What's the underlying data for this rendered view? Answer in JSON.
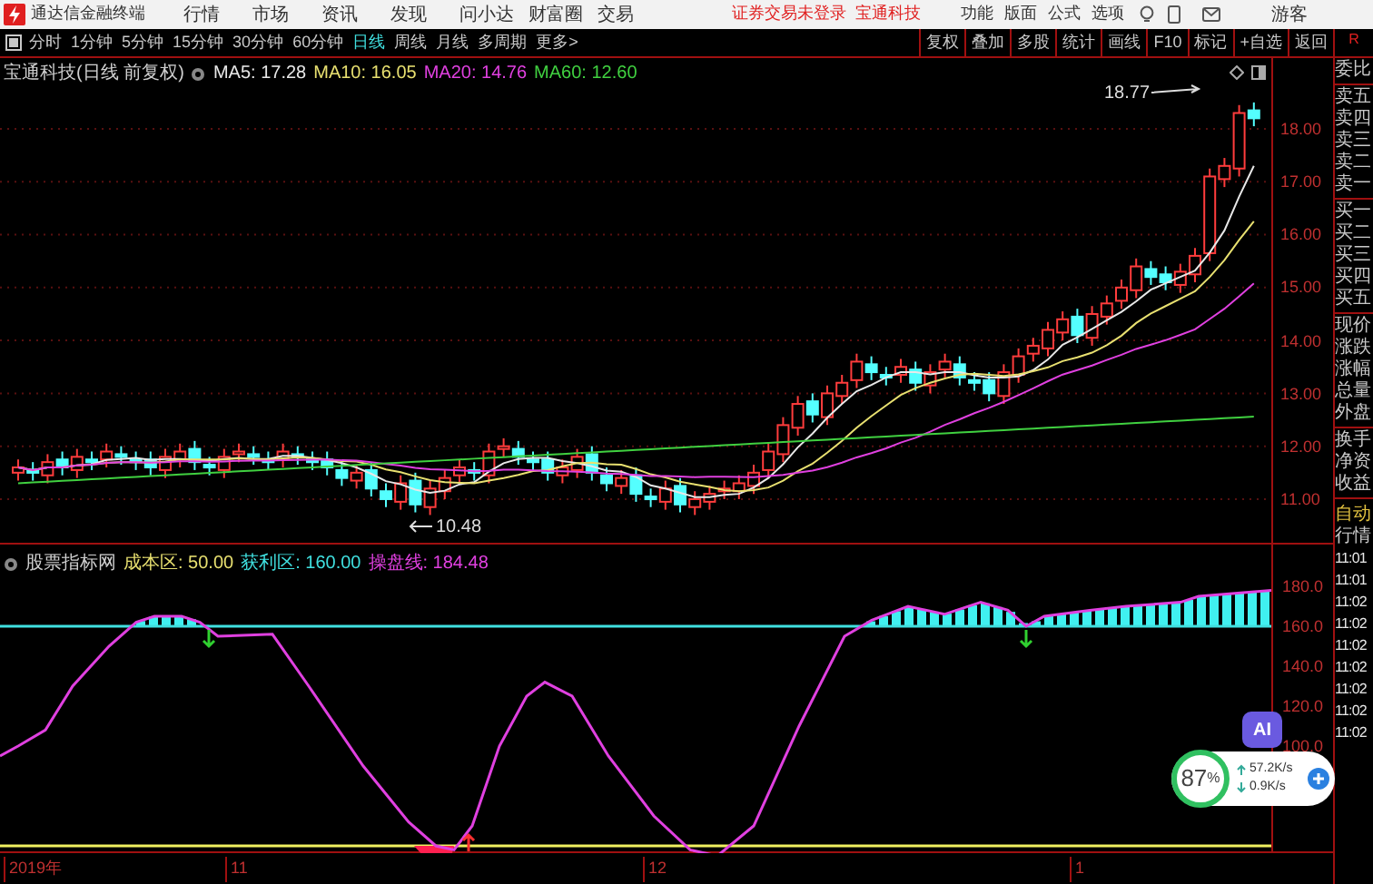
{
  "title_bar": {
    "app_name": "通达信金融终端",
    "menus": [
      "行情",
      "市场",
      "资讯",
      "发现",
      "问小达",
      "财富圈",
      "交易"
    ],
    "login_status": "证券交易未登录",
    "stock_name": "宝通科技",
    "tools": [
      "功能",
      "版面",
      "公式",
      "选项"
    ],
    "user": "游客"
  },
  "period_tabs": [
    {
      "label": "分时",
      "selected": false
    },
    {
      "label": "1分钟",
      "selected": false
    },
    {
      "label": "5分钟",
      "selected": false
    },
    {
      "label": "15分钟",
      "selected": false
    },
    {
      "label": "30分钟",
      "selected": false
    },
    {
      "label": "60分钟",
      "selected": false
    },
    {
      "label": "日线",
      "selected": true
    },
    {
      "label": "周线",
      "selected": false
    },
    {
      "label": "月线",
      "selected": false
    },
    {
      "label": "多周期",
      "selected": false
    },
    {
      "label": "更多>",
      "selected": false
    }
  ],
  "toolbar_buttons": [
    "复权",
    "叠加",
    "多股",
    "统计",
    "画线",
    "F10",
    "标记",
    "+自选",
    "返回"
  ],
  "panel_mark": "R",
  "main_chart": {
    "title": "宝通科技(日线 前复权)",
    "indicators": [
      {
        "label": "MA5: 17.28",
        "color": "#e8e8e8"
      },
      {
        "label": "MA10: 16.05",
        "color": "#e8e070"
      },
      {
        "label": "MA20: 14.76",
        "color": "#e040e0"
      },
      {
        "label": "MA60: 12.60",
        "color": "#40d040"
      }
    ],
    "high_label": "18.77",
    "low_label": "10.48",
    "price_ticks": [
      "18.00",
      "17.00",
      "16.00",
      "15.00",
      "14.00",
      "13.00",
      "12.00",
      "11.00"
    ]
  },
  "indicator_pane": {
    "title": "股票指标网",
    "values": [
      {
        "label": "成本区: 50.00",
        "color": "#e8e070"
      },
      {
        "label": "获利区: 160.00",
        "color": "#40e0e0"
      },
      {
        "label": "操盘线: 184.48",
        "color": "#e040e0"
      }
    ],
    "ticks": [
      "180.0",
      "160.0",
      "140.0",
      "120.0",
      "100.0"
    ]
  },
  "date_axis": [
    "2019年",
    "11",
    "12",
    "1"
  ],
  "quote_panel": [
    [
      "委比"
    ],
    [
      "卖五",
      "卖四",
      "卖三",
      "卖二",
      "卖一"
    ],
    [
      "买一",
      "买二",
      "买三",
      "买四",
      "买五"
    ],
    [
      "现价",
      "涨跌",
      "涨幅",
      "总量",
      "外盘"
    ],
    [
      "换手",
      "净资",
      "收益"
    ]
  ],
  "tick_panel": {
    "title": [
      "自动",
      "行情"
    ],
    "times": [
      "11:01",
      "11:01",
      "11:02",
      "11:02",
      "11:02",
      "11:02",
      "11:02",
      "11:02",
      "11:02"
    ]
  },
  "ai_button": "AI",
  "speed_widget": {
    "percent": "87",
    "unit": "%",
    "upload": "57.2K/s",
    "download": "0.9K/s"
  }
}
